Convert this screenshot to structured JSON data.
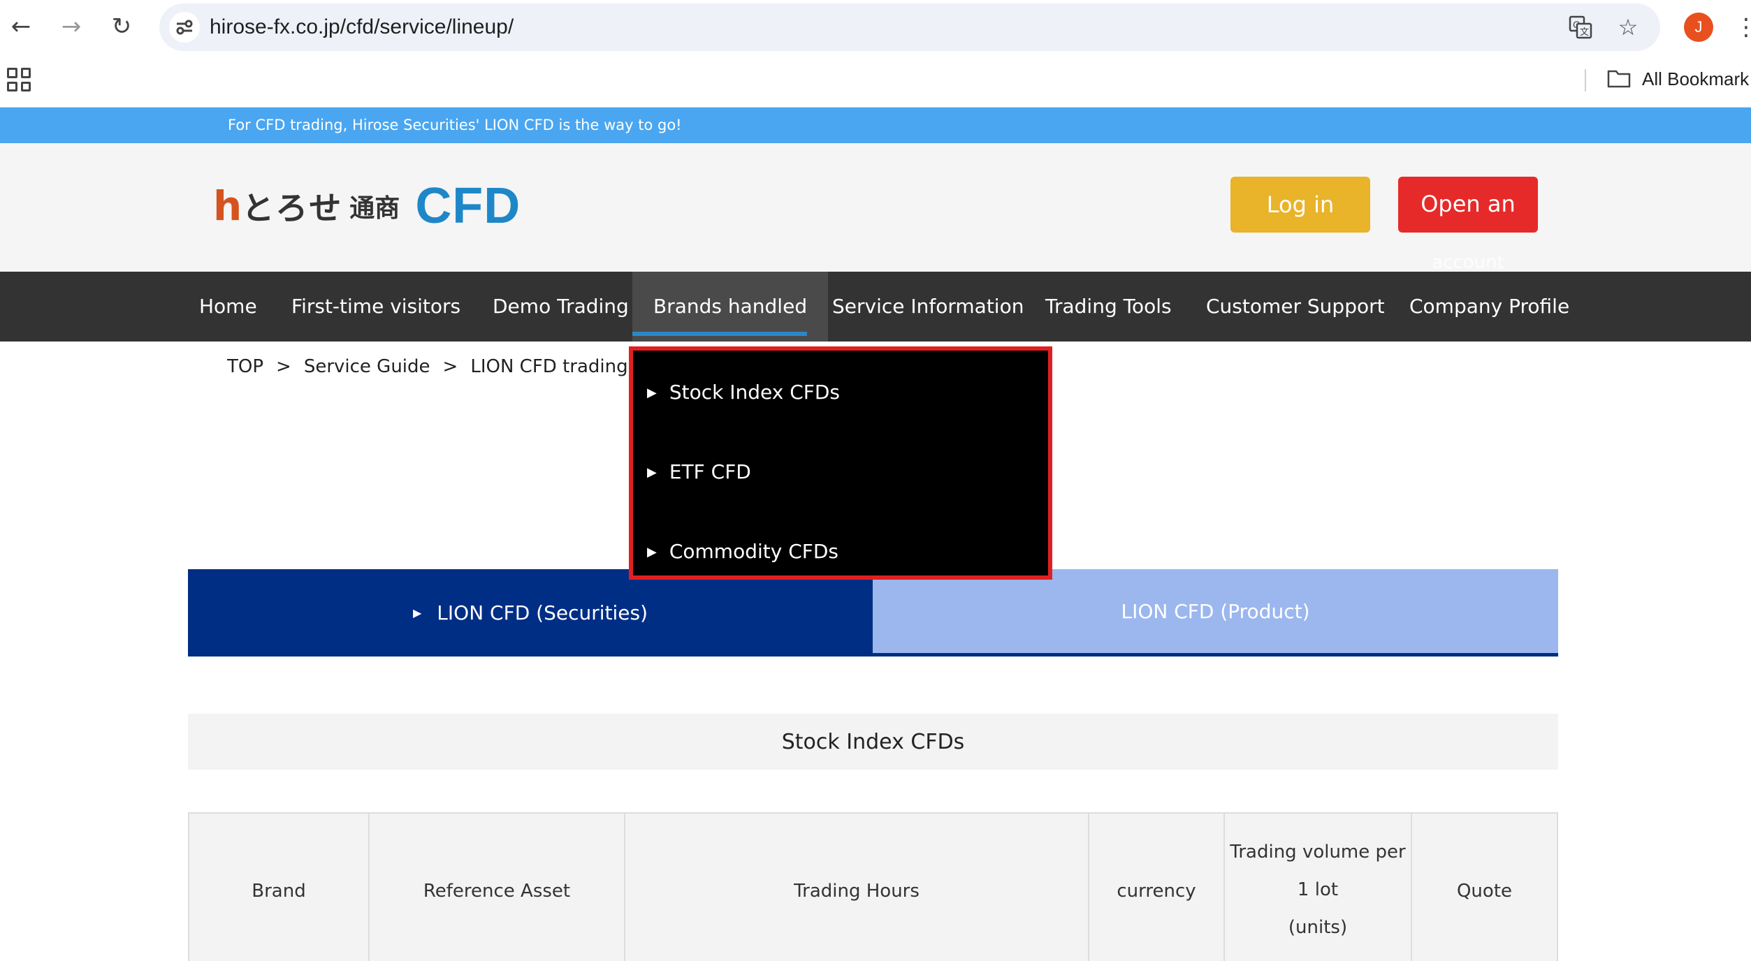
{
  "browser": {
    "url": "hirose-fx.co.jp/cfd/service/lineup/",
    "profile_initial": "J",
    "bookmarks_label": "All Bookmark"
  },
  "promo": {
    "text": "For CFD trading, Hirose Securities' LION CFD is the way to go!"
  },
  "header": {
    "logo_mark": "h",
    "logo_kana": "とろせ",
    "logo_kanji": "通商",
    "logo_cfd": "CFD",
    "login_label": "Log in",
    "open_label_line1": "Open an",
    "open_label_line2": "account"
  },
  "nav": {
    "items": [
      {
        "label": "Home"
      },
      {
        "label": "First-time visitors"
      },
      {
        "label": "Demo Trading"
      },
      {
        "label": "Brands handled"
      },
      {
        "label": "Service Information"
      },
      {
        "label": "Trading Tools"
      },
      {
        "label": "Customer Support"
      },
      {
        "label": "Company Profile"
      }
    ],
    "active_index": 3
  },
  "breadcrumb": {
    "items": [
      "TOP",
      "Service Guide",
      "LION CFD trading st"
    ],
    "separator": ">"
  },
  "dropdown": {
    "items": [
      {
        "label": "Stock Index CFDs"
      },
      {
        "label": "ETF CFD"
      },
      {
        "label": "Commodity CFDs"
      }
    ]
  },
  "tabs": {
    "securities": "LION CFD (Securities)",
    "product": "LION CFD (Product)"
  },
  "section": {
    "title": "Stock Index CFDs"
  },
  "table": {
    "headers": [
      "Brand",
      "Reference Asset",
      "Trading Hours",
      "currency",
      "Trading volume per",
      "Quote"
    ],
    "header_volume_line2": "1 lot",
    "header_volume_line3": "(units)"
  },
  "colors": {
    "promo_bar": "#4aa6f0",
    "nav_bg": "#333333",
    "login": "#e9b32a",
    "open_account": "#e62a2a",
    "tab_active": "#002e85",
    "tab_inactive": "#9bb7ee",
    "dropdown_highlight": "#e02020"
  }
}
